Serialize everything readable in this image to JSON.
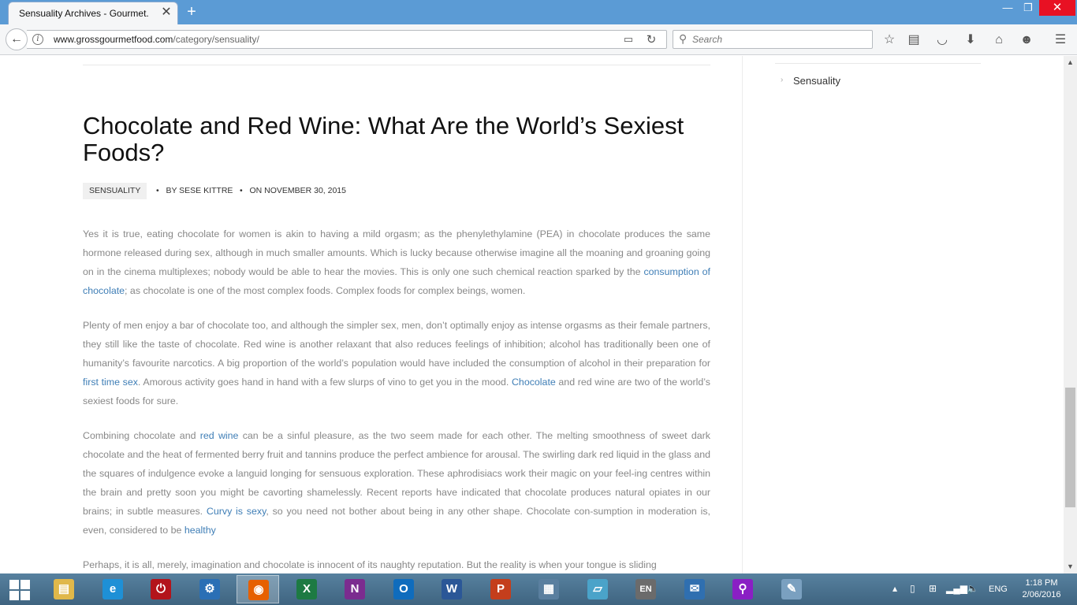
{
  "browser": {
    "tab_title": "Sensuality Archives - Gourmet...",
    "tab_close": "✕",
    "new_tab": "+",
    "window_min": "—",
    "window_max": "❐",
    "window_close": "✕",
    "url_host": "www.grossgourmetfood.com",
    "url_path": "/category/sensuality/",
    "search_placeholder": "Search",
    "icons": [
      "back-icon",
      "info-icon",
      "reader-view-icon",
      "reload-icon",
      "search-icon",
      "bookmark-star-icon",
      "reading-list-icon",
      "pocket-icon",
      "download-icon",
      "home-icon",
      "smiley-icon",
      "menu-icon"
    ]
  },
  "sidebar": {
    "items": [
      {
        "label": "Sensuality"
      }
    ]
  },
  "article": {
    "title": "Chocolate and Red Wine: What Are the World’s Sexiest Foods?",
    "category": "SENSUALITY",
    "author": "BY SESE KITTRE",
    "date": "ON NOVEMBER 30, 2015",
    "p1_a": "Yes it is true, eating chocolate for women is akin to having a mild orgasm; as the phenylethylamine (PEA) in chocolate produces the same hormone released during sex, although in much smaller amounts. Which is lucky because otherwise imagine all the moaning and groaning going on in the cinema multiplexes; nobody would be able to hear the movies. This is only one such chemical reaction sparked by the ",
    "p1_link": "consumption of chocolate",
    "p1_b": "; as chocolate is one of the most complex foods. Complex foods for complex beings, women.",
    "p2_a": "Plenty of men enjoy a bar of chocolate too, and although the simpler sex, men, don’t optimally enjoy as intense orgasms as their female partners, they still like the taste of chocolate. Red wine is another relaxant that also reduces feelings of inhibition; alcohol has traditionally been one of humanity’s favourite narcotics. A big proportion of the world’s population would have included the consumption of alcohol in their preparation for ",
    "p2_link1": "first time sex",
    "p2_b": ". Amorous activity goes hand in hand with a few slurps of vino to get you in the mood. ",
    "p2_link2": "Chocolate",
    "p2_c": " and red wine are two of the world’s sexiest foods for sure.",
    "p3_a": "Combining chocolate and ",
    "p3_link1": "red wine",
    "p3_b": " can be a sinful pleasure, as the two seem made for each other. The melting smoothness of sweet dark chocolate and the heat of fermented berry fruit and tannins produce the perfect ambience for arousal. The swirling dark red liquid in the glass and the squares of indulgence evoke a languid longing for sensuous exploration. These aphrodisiacs work their magic on your feel-ing centres within the brain and pretty soon you might be cavorting shamelessly. Recent reports have indicated that chocolate produces natural opiates in our brains; in subtle measures. ",
    "p3_link2": "Curvy is sexy",
    "p3_c": ", so you need not bother about being in any other shape. Chocolate con-sumption in moderation is, even, considered to be ",
    "p3_link3": "healthy",
    "p4": "Perhaps, it is all, merely, imagination and chocolate is innocent of its naughty reputation. But the reality is when your tongue is sliding"
  },
  "taskbar": {
    "apps": [
      {
        "name": "file-explorer",
        "glyph": "▤",
        "color": "#e0b84a"
      },
      {
        "name": "internet-explorer",
        "glyph": "e",
        "color": "#1e90d6"
      },
      {
        "name": "power-app",
        "glyph": "⏻",
        "color": "#b3141b"
      },
      {
        "name": "control-panel",
        "glyph": "⚙",
        "color": "#2a6fb5"
      },
      {
        "name": "firefox",
        "glyph": "◉",
        "color": "#e66000"
      },
      {
        "name": "excel",
        "glyph": "X",
        "color": "#1d7a43"
      },
      {
        "name": "onenote",
        "glyph": "N",
        "color": "#7b2c8f"
      },
      {
        "name": "outlook",
        "glyph": "O",
        "color": "#0f6cbd"
      },
      {
        "name": "word",
        "glyph": "W",
        "color": "#2b5797"
      },
      {
        "name": "powerpoint",
        "glyph": "P",
        "color": "#c43e1c"
      },
      {
        "name": "task-manager",
        "glyph": "▦",
        "color": "#5a7f9f"
      },
      {
        "name": "notes",
        "glyph": "▱",
        "color": "#4aa3c9"
      },
      {
        "name": "language-bar",
        "glyph": "EN",
        "color": "#6b6b6b"
      },
      {
        "name": "thunderbird",
        "glyph": "✉",
        "color": "#2f6fb0"
      },
      {
        "name": "search-app",
        "glyph": "⚲",
        "color": "#8a1fc4"
      },
      {
        "name": "paint",
        "glyph": "✎",
        "color": "#7aa0c0"
      }
    ],
    "language": "ENG",
    "time": "1:18 PM",
    "date": "2/06/2016"
  }
}
